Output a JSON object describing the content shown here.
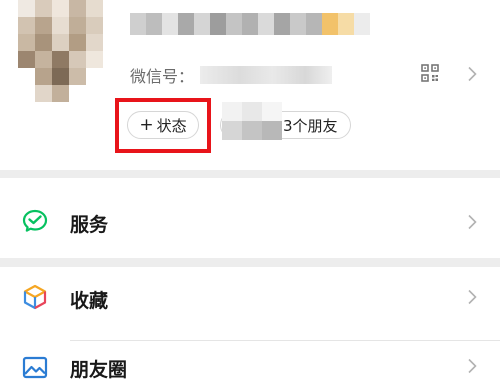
{
  "profile": {
    "wechat_id_label": "微信号：",
    "status_button": {
      "plus": "+",
      "label": "状态"
    },
    "friends_suffix": "3个朋友",
    "highlight_color": "#e8141a"
  },
  "menu": {
    "items": [
      {
        "label": "服务",
        "icon": "wechat-pay-icon",
        "color": "#07c160"
      },
      {
        "label": "收藏",
        "icon": "favorites-cube-icon",
        "color": "#f5a623"
      },
      {
        "label": "朋友圈",
        "icon": "moments-photo-icon",
        "color": "#2b7cd3"
      }
    ]
  }
}
